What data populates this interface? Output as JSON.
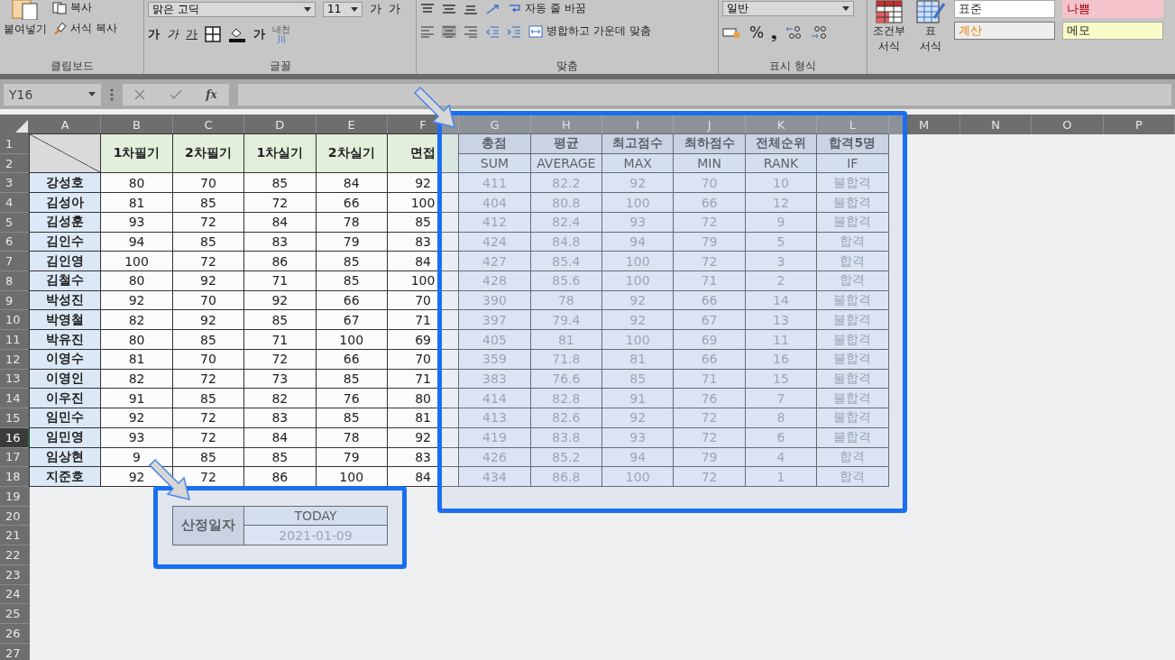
{
  "ribbon": {
    "clipboard": {
      "label": "클립보드",
      "paste": "붙여넣기",
      "copy": "복사",
      "format_painter": "서식 복사"
    },
    "font": {
      "label": "글꼴",
      "font_name": "맑은 고딕",
      "font_size": "11",
      "grow": "가",
      "shrink": "가",
      "bold": "가",
      "italic": "가",
      "underline": "가",
      "font_color": "가",
      "phonetic_top": "내천",
      "phonetic_bottom": "川"
    },
    "alignment": {
      "label": "맞춤",
      "wrap": "자동 줄 바꿈",
      "merge": "병합하고 가운데 맞춤"
    },
    "number": {
      "label": "표시 형식",
      "format": "일반",
      "percent": "%",
      "comma": "❟"
    },
    "styles": {
      "conditional_top": "조건부",
      "conditional_bottom": "서식",
      "table_top": "표",
      "table_bottom": "서식",
      "cells": [
        {
          "label": "표준",
          "kind": "normal"
        },
        {
          "label": "나쁨",
          "kind": "bad"
        },
        {
          "label": "계산",
          "kind": "calculation"
        },
        {
          "label": "메모",
          "kind": "note"
        }
      ]
    }
  },
  "formula_bar": {
    "name_box": "Y16",
    "function_button": "fx"
  },
  "columns": [
    "A",
    "B",
    "C",
    "D",
    "E",
    "F",
    "G",
    "H",
    "I",
    "J",
    "K",
    "L",
    "M",
    "N",
    "O",
    "P"
  ],
  "rows": [
    {
      "label": "1",
      "selected": false
    },
    {
      "label": "2",
      "selected": false
    },
    {
      "label": "3",
      "selected": false
    },
    {
      "label": "4",
      "selected": false
    },
    {
      "label": "5",
      "selected": false
    },
    {
      "label": "6",
      "selected": false
    },
    {
      "label": "7",
      "selected": false
    },
    {
      "label": "8",
      "selected": false
    },
    {
      "label": "9",
      "selected": false
    },
    {
      "label": "10",
      "selected": false
    },
    {
      "label": "11",
      "selected": false
    },
    {
      "label": "12",
      "selected": false
    },
    {
      "label": "13",
      "selected": false
    },
    {
      "label": "14",
      "selected": false
    },
    {
      "label": "15",
      "selected": false
    },
    {
      "label": "16",
      "selected": true
    },
    {
      "label": "17",
      "selected": false
    },
    {
      "label": "18",
      "selected": false
    },
    {
      "label": "19",
      "selected": false
    },
    {
      "label": "20",
      "selected": false
    },
    {
      "label": "21",
      "selected": false
    },
    {
      "label": "22",
      "selected": false
    },
    {
      "label": "23",
      "selected": false
    },
    {
      "label": "24",
      "selected": false
    },
    {
      "label": "25",
      "selected": false
    },
    {
      "label": "26",
      "selected": false
    },
    {
      "label": "27",
      "selected": false
    }
  ],
  "score_table": {
    "headers": [
      "1차필기",
      "2차필기",
      "1차실기",
      "2차실기",
      "면접"
    ],
    "rows": [
      {
        "name": "강성호",
        "scores": [
          "80",
          "70",
          "85",
          "84",
          "92"
        ]
      },
      {
        "name": "김성아",
        "scores": [
          "81",
          "85",
          "72",
          "66",
          "100"
        ]
      },
      {
        "name": "김성훈",
        "scores": [
          "93",
          "72",
          "84",
          "78",
          "85"
        ]
      },
      {
        "name": "김인수",
        "scores": [
          "94",
          "85",
          "83",
          "79",
          "83"
        ]
      },
      {
        "name": "김인영",
        "scores": [
          "100",
          "72",
          "86",
          "85",
          "84"
        ]
      },
      {
        "name": "김철수",
        "scores": [
          "80",
          "92",
          "71",
          "85",
          "100"
        ]
      },
      {
        "name": "박성진",
        "scores": [
          "92",
          "70",
          "92",
          "66",
          "70"
        ]
      },
      {
        "name": "박영철",
        "scores": [
          "82",
          "92",
          "85",
          "67",
          "71"
        ]
      },
      {
        "name": "박유진",
        "scores": [
          "80",
          "85",
          "71",
          "100",
          "69"
        ]
      },
      {
        "name": "이영수",
        "scores": [
          "81",
          "70",
          "72",
          "66",
          "70"
        ]
      },
      {
        "name": "이영인",
        "scores": [
          "82",
          "72",
          "73",
          "85",
          "71"
        ]
      },
      {
        "name": "이우진",
        "scores": [
          "91",
          "85",
          "82",
          "76",
          "80"
        ]
      },
      {
        "name": "임민수",
        "scores": [
          "92",
          "72",
          "83",
          "85",
          "81"
        ]
      },
      {
        "name": "임민영",
        "scores": [
          "93",
          "72",
          "84",
          "78",
          "92"
        ]
      },
      {
        "name": "임상현",
        "scores": [
          "9",
          "85",
          "85",
          "79",
          "83"
        ]
      },
      {
        "name": "지준호",
        "scores": [
          "92",
          "72",
          "86",
          "100",
          "84"
        ]
      }
    ]
  },
  "result_table": {
    "headers": [
      {
        "title": "총점",
        "function": "SUM"
      },
      {
        "title": "평균",
        "function": "AVERAGE"
      },
      {
        "title": "최고점수",
        "function": "MAX"
      },
      {
        "title": "최하점수",
        "function": "MIN"
      },
      {
        "title": "전체순위",
        "function": "RANK"
      },
      {
        "title": "합격5명",
        "function": "IF"
      }
    ],
    "rows": [
      [
        "411",
        "82.2",
        "92",
        "70",
        "10",
        "불합격"
      ],
      [
        "404",
        "80.8",
        "100",
        "66",
        "12",
        "불합격"
      ],
      [
        "412",
        "82.4",
        "93",
        "72",
        "9",
        "불합격"
      ],
      [
        "424",
        "84.8",
        "94",
        "79",
        "5",
        "합격"
      ],
      [
        "427",
        "85.4",
        "100",
        "72",
        "3",
        "합격"
      ],
      [
        "428",
        "85.6",
        "100",
        "71",
        "2",
        "합격"
      ],
      [
        "390",
        "78",
        "92",
        "66",
        "14",
        "불합격"
      ],
      [
        "397",
        "79.4",
        "92",
        "67",
        "13",
        "불합격"
      ],
      [
        "405",
        "81",
        "100",
        "69",
        "11",
        "불합격"
      ],
      [
        "359",
        "71.8",
        "81",
        "66",
        "16",
        "불합격"
      ],
      [
        "383",
        "76.6",
        "85",
        "71",
        "15",
        "불합격"
      ],
      [
        "414",
        "82.8",
        "91",
        "76",
        "7",
        "불합격"
      ],
      [
        "413",
        "82.6",
        "92",
        "72",
        "8",
        "불합격"
      ],
      [
        "419",
        "83.8",
        "93",
        "72",
        "6",
        "불합격"
      ],
      [
        "426",
        "85.2",
        "94",
        "79",
        "4",
        "합격"
      ],
      [
        "434",
        "86.8",
        "100",
        "72",
        "1",
        "합격"
      ]
    ]
  },
  "date_box": {
    "label": "산정일자",
    "function": "TODAY",
    "value": "2021-01-09"
  }
}
